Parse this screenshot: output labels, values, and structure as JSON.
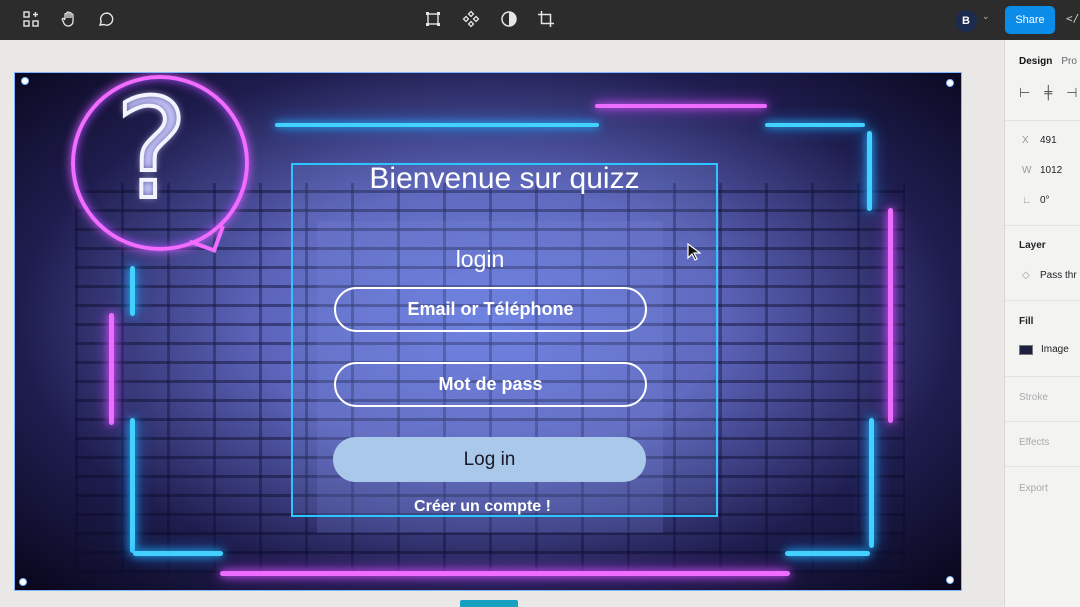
{
  "toolbar": {
    "left_icons": [
      "frame-add-icon",
      "hand-icon",
      "comment-icon"
    ],
    "center_icons": [
      "frame-select-icon",
      "component-icon",
      "contrast-icon",
      "crop-icon"
    ],
    "avatar_initial": "B",
    "share_label": "Share",
    "code_label": "</"
  },
  "panel": {
    "tab_design": "Design",
    "tab_prototype": "Pro",
    "x_key": "X",
    "x_value": "491",
    "w_key": "W",
    "w_value": "1012",
    "rotation_key": "∟",
    "rotation_value": "0°",
    "layer_label": "Layer",
    "layer_blend": "Pass thr",
    "fill_label": "Fill",
    "fill_type": "Image",
    "fill_swatch_color": "#1d1f3f",
    "stroke_label": "Stroke",
    "effects_label": "Effects",
    "export_label": "Export"
  },
  "design": {
    "title": "Bienvenue sur quizz",
    "login_label": "login",
    "email_placeholder": "Email or Téléphone",
    "password_placeholder": "Mot de pass",
    "login_button": "Log in",
    "create_account_link": "Créer un compte !"
  },
  "colors": {
    "share_blue": "#0c8ce9",
    "neon_pink": "#ee6cff",
    "neon_cyan": "#43d2ff",
    "login_button_bg": "#a9c8ea"
  }
}
